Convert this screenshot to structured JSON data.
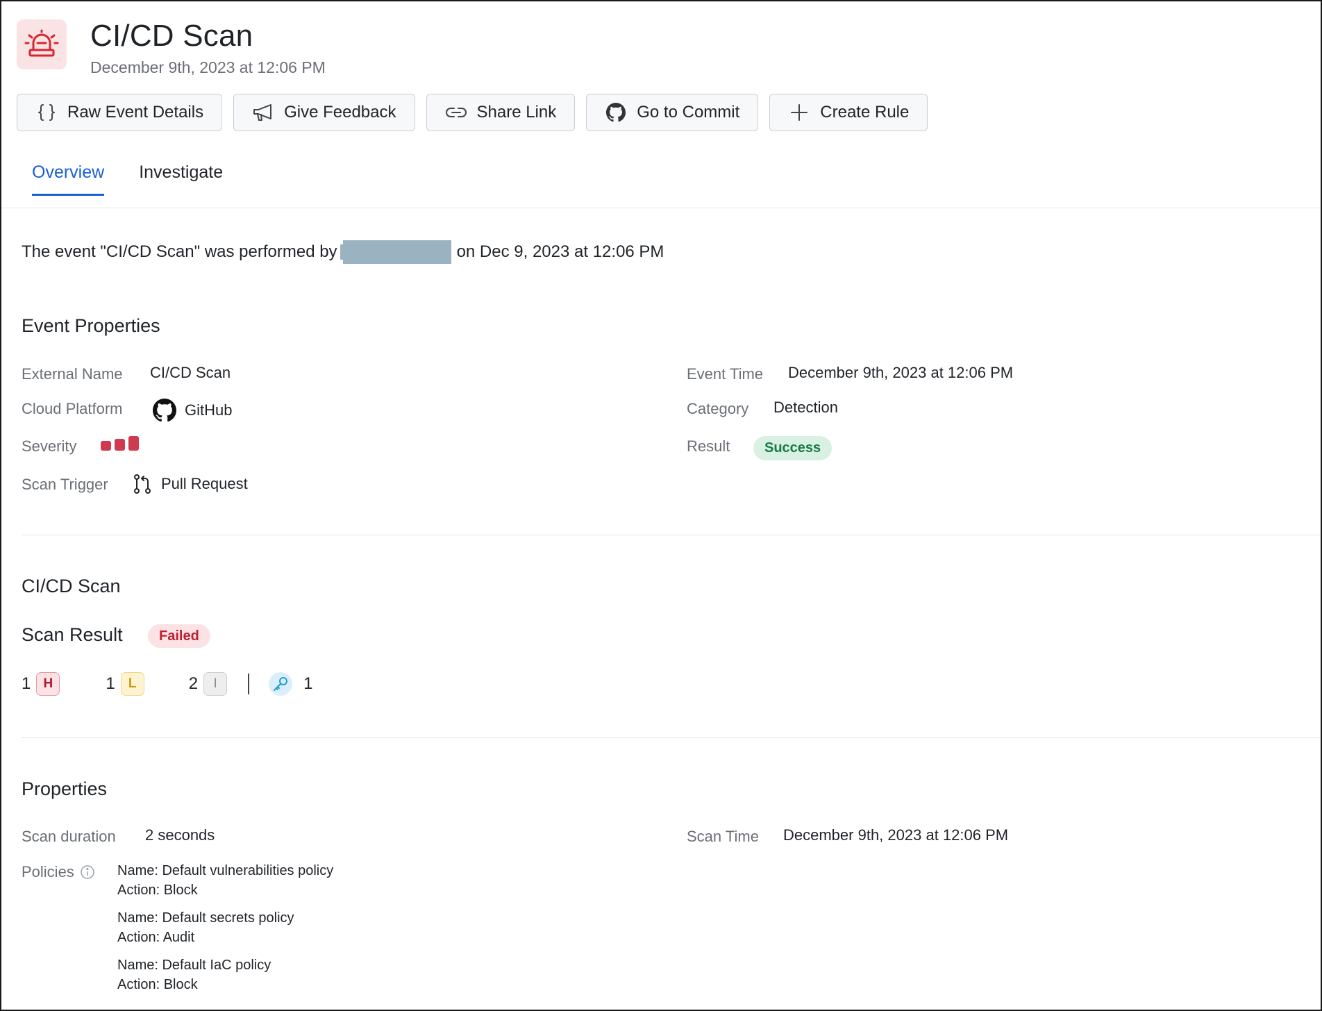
{
  "header": {
    "title": "CI/CD Scan",
    "subtitle": "December 9th, 2023 at 12:06 PM",
    "icon": "siren-icon",
    "icon_color": "#d8262f"
  },
  "toolbar": [
    {
      "label": "Raw Event Details",
      "icon": "braces-icon"
    },
    {
      "label": "Give Feedback",
      "icon": "megaphone-icon"
    },
    {
      "label": "Share Link",
      "icon": "link-icon"
    },
    {
      "label": "Go to Commit",
      "icon": "github-icon"
    },
    {
      "label": "Create Rule",
      "icon": "plus-icon"
    }
  ],
  "tabs": [
    {
      "label": "Overview",
      "active": true
    },
    {
      "label": "Investigate",
      "active": false
    }
  ],
  "summary": {
    "prefix": "The event \"CI/CD Scan\" was performed by",
    "suffix": "on Dec 9, 2023 at 12:06 PM"
  },
  "event_properties": {
    "title": "Event Properties",
    "external_name_label": "External Name",
    "external_name": "CI/CD Scan",
    "cloud_platform_label": "Cloud Platform",
    "cloud_platform": "GitHub",
    "severity_label": "Severity",
    "severity_level": 3,
    "scan_trigger_label": "Scan Trigger",
    "scan_trigger": "Pull Request",
    "event_time_label": "Event Time",
    "event_time": "December 9th, 2023 at 12:06 PM",
    "category_label": "Category",
    "category": "Detection",
    "result_label": "Result",
    "result": "Success"
  },
  "cicd_scan": {
    "title": "CI/CD Scan",
    "scan_result_label": "Scan Result",
    "scan_result": "Failed",
    "counts": {
      "high": "1",
      "high_badge": "H",
      "low": "1",
      "low_badge": "L",
      "info": "2",
      "info_badge": "I",
      "secrets": "1"
    }
  },
  "properties": {
    "title": "Properties",
    "scan_duration_label": "Scan duration",
    "scan_duration": "2 seconds",
    "scan_time_label": "Scan Time",
    "scan_time": "December 9th, 2023 at 12:06 PM",
    "policies_label": "Policies",
    "policies": [
      {
        "name": "Name: Default vulnerabilities policy",
        "action": "Action: Block"
      },
      {
        "name": "Name: Default secrets policy",
        "action": "Action: Audit"
      },
      {
        "name": "Name: Default IaC policy",
        "action": "Action: Block"
      }
    ]
  },
  "colors": {
    "accent": "#1a5fd6",
    "severity": "#cf3a4f",
    "success": "#1a7a45",
    "failed": "#c01f33"
  }
}
